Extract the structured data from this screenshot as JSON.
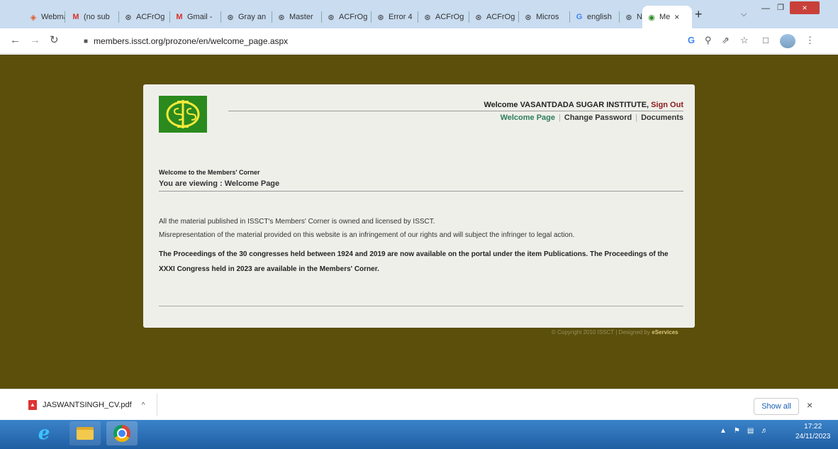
{
  "browser": {
    "tabs": [
      {
        "label": "Webma",
        "icon": "webmail-icon"
      },
      {
        "label": "(no sub",
        "icon": "gmail-icon"
      },
      {
        "label": "ACFrOg",
        "icon": "globe-icon"
      },
      {
        "label": "Gmail -",
        "icon": "gmail-icon"
      },
      {
        "label": "Gray an",
        "icon": "globe-icon"
      },
      {
        "label": "Master",
        "icon": "globe-icon"
      },
      {
        "label": "ACFrOg",
        "icon": "globe-icon"
      },
      {
        "label": "Error 4",
        "icon": "globe-icon"
      },
      {
        "label": "ACFrOg",
        "icon": "globe-icon"
      },
      {
        "label": "ACFrOg",
        "icon": "globe-icon"
      },
      {
        "label": "Micros",
        "icon": "globe-icon"
      },
      {
        "label": "english",
        "icon": "google-icon"
      },
      {
        "label": "New Ta",
        "icon": "chrome-icon"
      },
      {
        "label": "Me",
        "icon": "site-icon",
        "active": true
      }
    ],
    "url": "members.issct.org/prozone/en/welcome_page.aspx",
    "new_tab": "+",
    "close_glyph": "×"
  },
  "page": {
    "logo_text": "ISSCT",
    "welcome_prefix": "Welcome VASANTDADA SUGAR INSTITUTE,",
    "sign_out": "Sign Out",
    "nav": {
      "welcome": "Welcome Page",
      "change_password": "Change Password",
      "documents": "Documents",
      "separator": "|"
    },
    "corner_title": "Welcome to the Members' Corner",
    "viewing": "You are viewing : Welcome Page",
    "para1": "All the material published in ISSCT's Members' Corner is owned and licensed by ISSCT.",
    "para2": "Misrepresentation of the material provided on this website is an infringement of our rights and will subject the infringer to legal action.",
    "para3": "The Proceedings of the 30 congresses held between 1924 and 2019 are now available on the portal under the item Publications. The Proceedings of the XXXI Congress held in 2023 are available in the Members' Corner.",
    "copyright": "© Copyright 2010 ISSCT | Designed by",
    "designer": "eServices"
  },
  "downloads": {
    "file": "JASWANTSINGH_CV.pdf",
    "show_all": "Show all"
  },
  "taskbar": {
    "time": "17:22",
    "date": "24/11/2023"
  },
  "colors": {
    "page_bg": "#5b4f0b",
    "logo_bg": "#2a8a1e",
    "sign_out": "#8b1a1a",
    "nav_active": "#2e7d5a"
  }
}
